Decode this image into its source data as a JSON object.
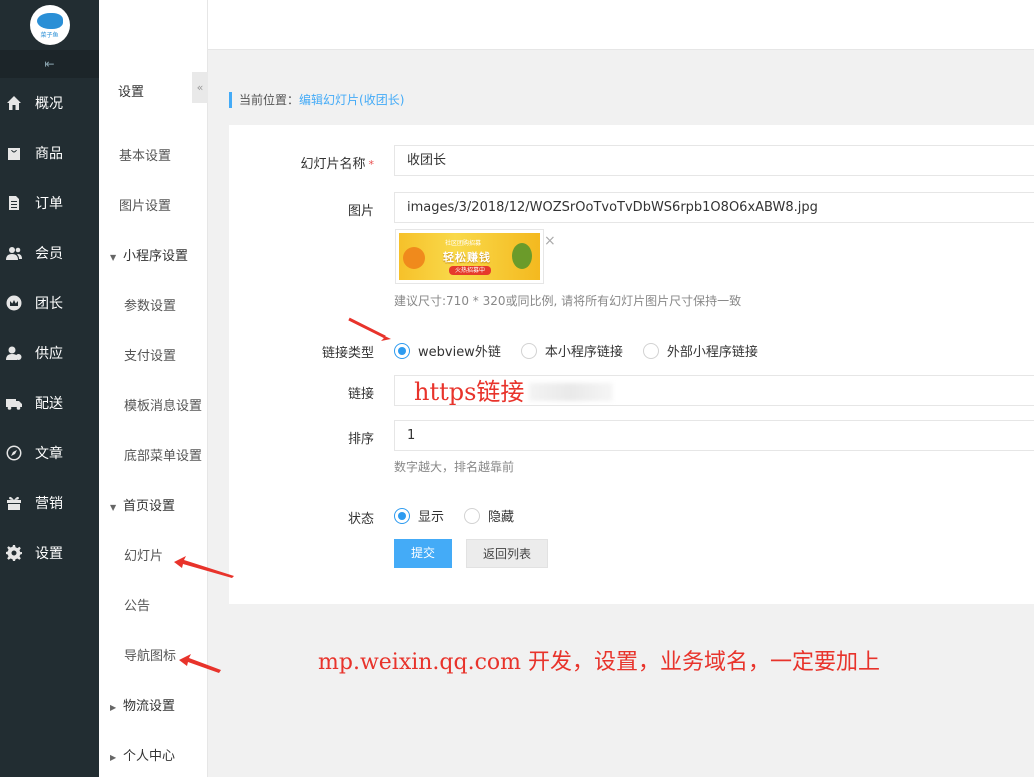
{
  "logo": {
    "text": "菜子鱼"
  },
  "nav": {
    "collapse_icon": "collapse-left-icon",
    "items": [
      {
        "label": "概况",
        "icon": "home-icon"
      },
      {
        "label": "商品",
        "icon": "bag-icon"
      },
      {
        "label": "订单",
        "icon": "document-icon"
      },
      {
        "label": "会员",
        "icon": "users-icon"
      },
      {
        "label": "团长",
        "icon": "crown-icon"
      },
      {
        "label": "供应",
        "icon": "supplier-icon"
      },
      {
        "label": "配送",
        "icon": "truck-icon"
      },
      {
        "label": "文章",
        "icon": "compass-icon"
      },
      {
        "label": "营销",
        "icon": "gift-icon"
      },
      {
        "label": "设置",
        "icon": "gear-icon"
      }
    ]
  },
  "submenu": {
    "title": "设置",
    "toggle": "«",
    "items": [
      {
        "label": "基本设置"
      },
      {
        "label": "图片设置"
      },
      {
        "label": "小程序设置",
        "caret": "▼"
      },
      {
        "label": "参数设置"
      },
      {
        "label": "支付设置"
      },
      {
        "label": "模板消息设置"
      },
      {
        "label": "底部菜单设置"
      },
      {
        "label": "首页设置",
        "caret": "▼"
      },
      {
        "label": "幻灯片"
      },
      {
        "label": "公告"
      },
      {
        "label": "导航图标"
      },
      {
        "label": "物流设置",
        "caret": "▶"
      },
      {
        "label": "个人中心",
        "caret": "▶"
      }
    ]
  },
  "breadcrumb": {
    "prefix": "当前位置：",
    "current": "编辑幻灯片(收团长)"
  },
  "form": {
    "name_label": "幻灯片名称",
    "required_mark": "*",
    "name_value": "收团长",
    "image_label": "图片",
    "image_value": "images/3/2018/12/WOZSrOoTvoTvDbWS6rpb1O8O6xABW8.jpg",
    "image_caption": "轻松赚钱",
    "image_small": "社区团购招募",
    "image_pill": "火热招募中",
    "remove": "×",
    "image_help": "建议尺寸:710 * 320或同比例, 请将所有幻灯片图片尺寸保持一致",
    "link_type_label": "链接类型",
    "link_types": [
      "webview外链",
      "本小程序链接",
      "外部小程序链接"
    ],
    "link_type_selected": 0,
    "link_label": "链接",
    "link_overlay": "https链接",
    "sort_label": "排序",
    "sort_value": "1",
    "sort_help": "数字越大，排名越靠前",
    "status_label": "状态",
    "status_options": [
      "显示",
      "隐藏"
    ],
    "status_selected": 0,
    "submit": "提交",
    "back": "返回列表"
  },
  "annotation": "mp.weixin.qq.com  开发，设置，业务域名，一定要加上",
  "colors": {
    "accent": "#44abf7",
    "nav_bg": "#222d32",
    "annotation": "#e8332b"
  }
}
